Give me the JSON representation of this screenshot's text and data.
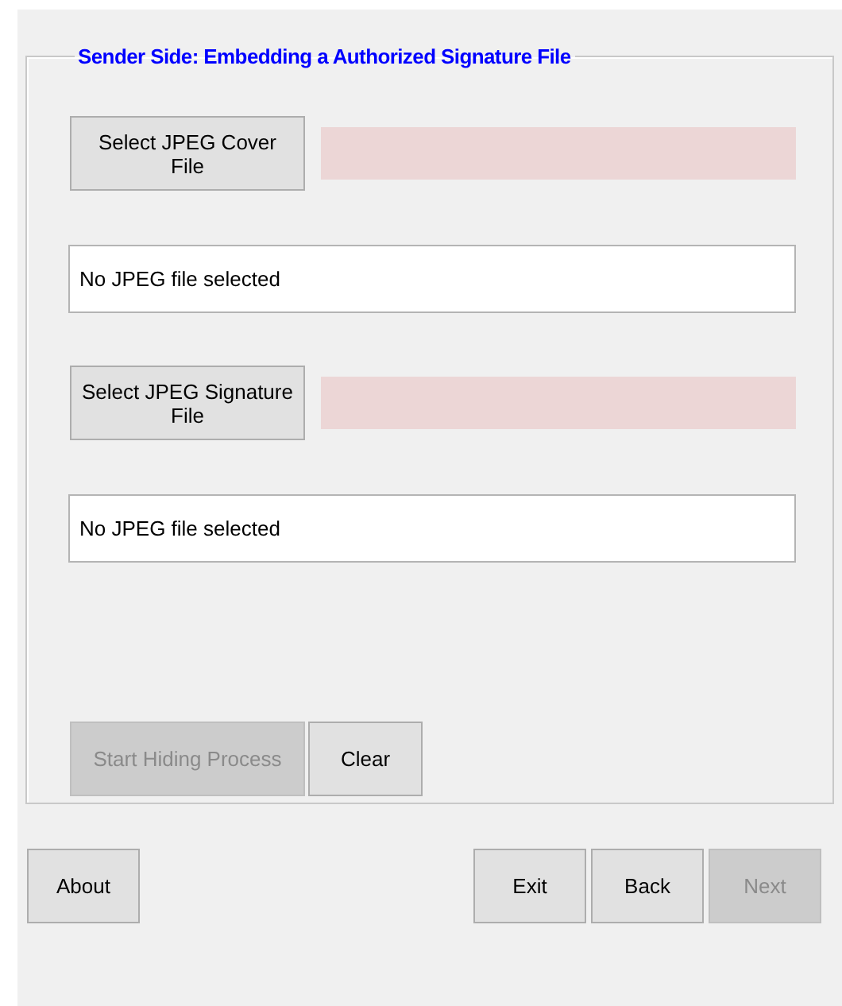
{
  "group": {
    "title": "Sender Side: Embedding a Authorized Signature File",
    "file_pickers": [
      {
        "button": {
          "label": "Select JPEG Cover File",
          "disabled": false
        },
        "path_field": {
          "value": "No JPEG file selected"
        }
      },
      {
        "button": {
          "label": "Select JPEG Signature File",
          "disabled": false
        },
        "path_field": {
          "value": "No JPEG file selected"
        }
      }
    ],
    "actions": [
      {
        "label": "Start Hiding Process",
        "disabled": true
      },
      {
        "label": "Clear",
        "disabled": false
      }
    ]
  },
  "footer_left": [
    {
      "label": "About",
      "disabled": false
    }
  ],
  "footer_right": [
    {
      "label": "Exit",
      "disabled": false
    },
    {
      "label": "Back",
      "disabled": false
    },
    {
      "label": "Next",
      "disabled": true
    }
  ]
}
